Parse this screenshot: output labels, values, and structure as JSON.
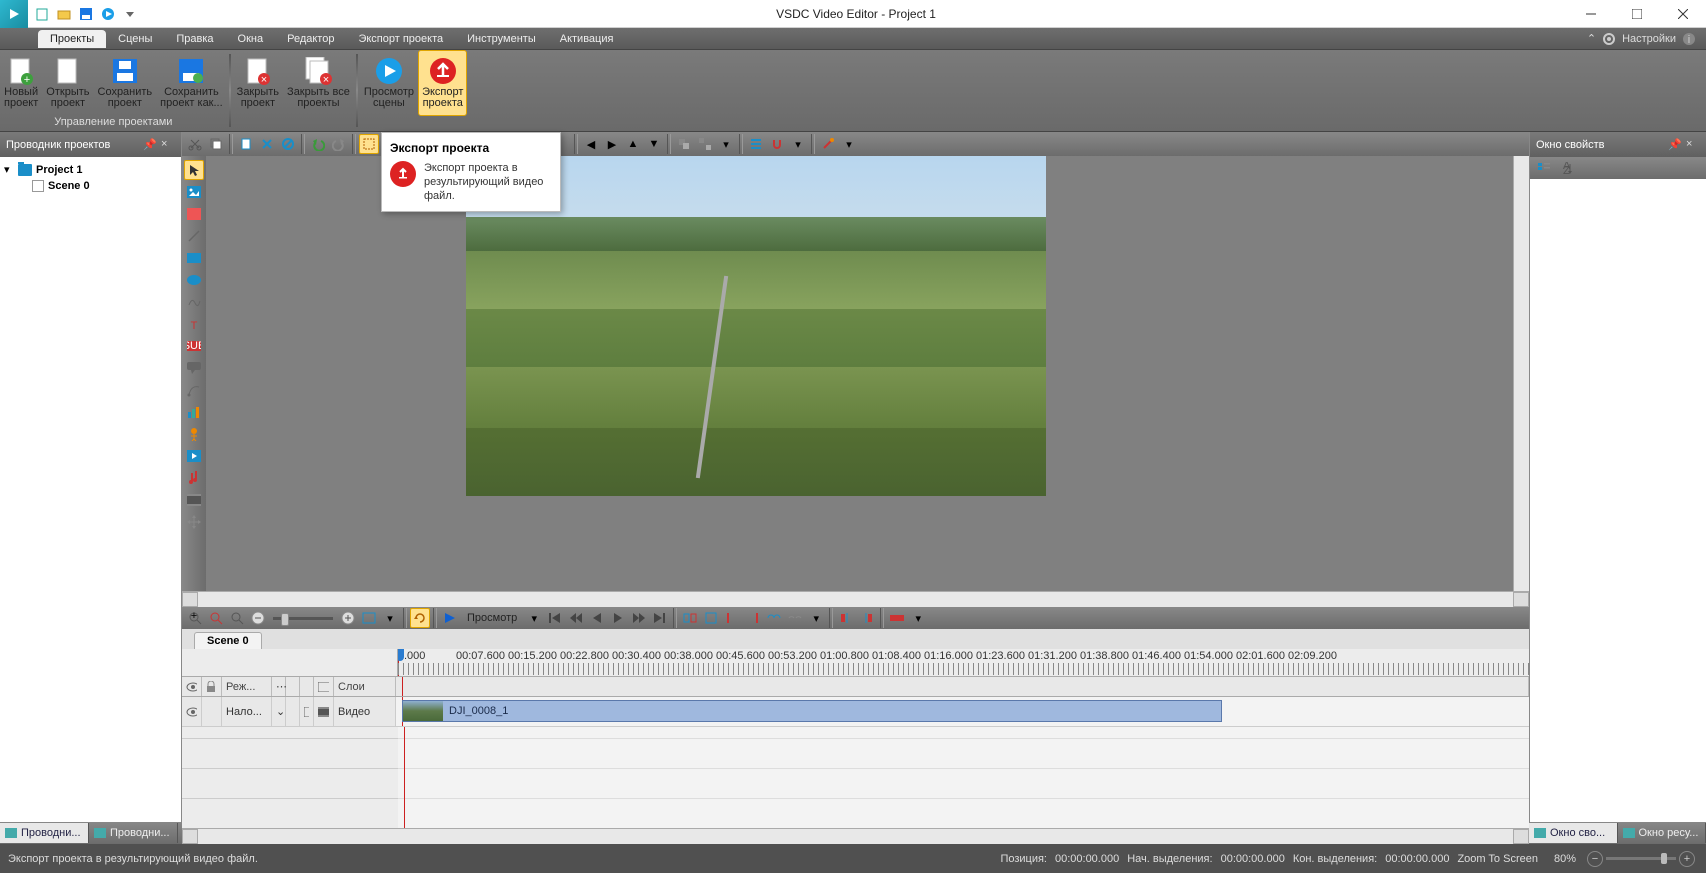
{
  "app": {
    "title": "VSDC Video Editor - Project 1"
  },
  "menu": {
    "tabs": [
      "Проекты",
      "Сцены",
      "Правка",
      "Окна",
      "Редактор",
      "Экспорт проекта",
      "Инструменты",
      "Активация"
    ],
    "settings": "Настройки"
  },
  "ribbon": {
    "buttons": [
      "Новый\nпроект",
      "Открыть\nпроект",
      "Сохранить\nпроект",
      "Сохранить\nпроект как...",
      "Закрыть\nпроект",
      "Закрыть все\nпроекты",
      "Просмотр\nсцены",
      "Экспорт\nпроекта"
    ],
    "group_label": "Управление проектами"
  },
  "tooltip": {
    "title": "Экспорт проекта",
    "text": "Экспорт проекта в результирующий видео файл."
  },
  "left_panel": {
    "title": "Проводник проектов",
    "tree": {
      "project": "Project 1",
      "scene": "Scene 0"
    },
    "bottom_tabs": [
      "Проводни...",
      "Проводни..."
    ]
  },
  "right_panel": {
    "title": "Окно свойств",
    "bottom_tabs": [
      "Окно сво...",
      "Окно ресу..."
    ]
  },
  "playback": {
    "preview_label": "Просмотр"
  },
  "scene_tab": "Scene 0",
  "timeline": {
    "ruler": [
      ".000",
      "00:07.600",
      "00:15.200",
      "00:22.800",
      "00:30.400",
      "00:38.000",
      "00:45.600",
      "00:53.200",
      "01:00.800",
      "01:08.400",
      "01:16.000",
      "01:23.600",
      "01:31.200",
      "01:38.800",
      "01:46.400",
      "01:54.000",
      "02:01.600",
      "02:09.200"
    ],
    "col_headers": {
      "mode": "Реж...",
      "layers": "Слои"
    },
    "track": {
      "overlay": "Нало...",
      "type": "Видео",
      "clip": "DJI_0008_1"
    }
  },
  "status": {
    "hint": "Экспорт проекта в результирующий видео файл.",
    "pos_label": "Позиция:",
    "pos": "00:00:00.000",
    "selstart_label": "Нач. выделения:",
    "selstart": "00:00:00.000",
    "selend_label": "Кон. выделения:",
    "selend": "00:00:00.000",
    "zoom_label": "Zoom To Screen",
    "zoom": "80%"
  }
}
